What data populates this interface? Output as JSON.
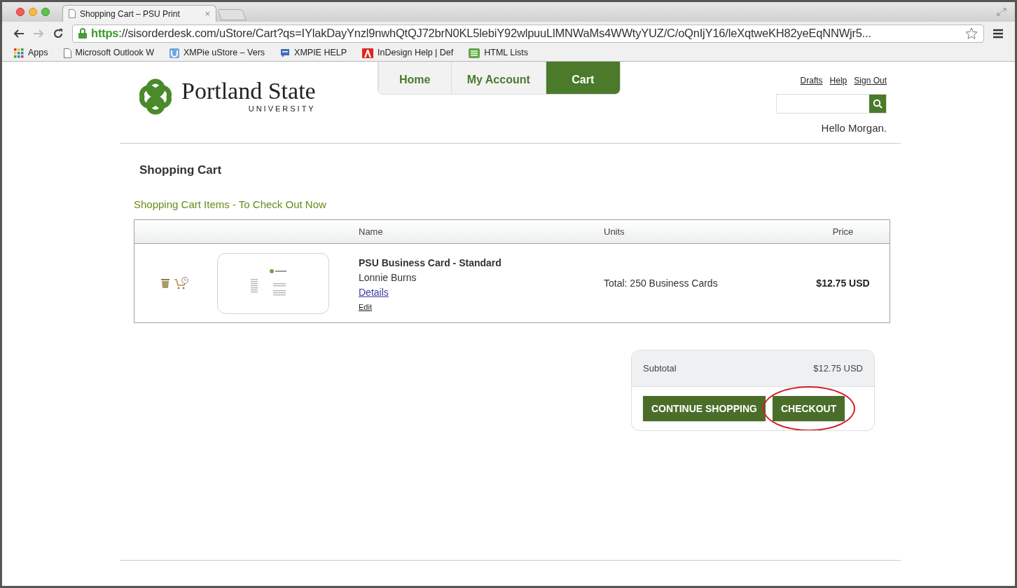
{
  "browser": {
    "tab_title": "Shopping Cart – PSU Print",
    "tab_close": "×",
    "url_scheme": "https",
    "url_rest": "://sisorderdesk.com/uStore/Cart?qs=IYlakDayYnzl9nwhQtQJ72brN0KL5lebiY92wlpuuLlMNWaMs4WWtyYUZ/C/oQnIjY16/leXqtweKH82yeEqNNWjr5...",
    "bookmarks": [
      {
        "label": "Apps",
        "kind": "apps"
      },
      {
        "label": "Microsoft Outlook W",
        "kind": "page"
      },
      {
        "label": "XMPie uStore – Vers",
        "kind": "ustore"
      },
      {
        "label": "XMPIE HELP",
        "kind": "help"
      },
      {
        "label": "InDesign Help | Def",
        "kind": "adobe"
      },
      {
        "label": "HTML Lists",
        "kind": "lists"
      }
    ]
  },
  "site": {
    "logo_name": "Portland State",
    "logo_sub": "UNIVERSITY",
    "nav": [
      {
        "label": "Home",
        "selected": false
      },
      {
        "label": "My Account",
        "selected": false
      },
      {
        "label": "Cart",
        "selected": true
      }
    ],
    "top_links": [
      "Drafts",
      "Help",
      "Sign Out"
    ],
    "greeting": "Hello Morgan."
  },
  "page_title": "Shopping Cart",
  "section_title": "Shopping Cart Items - To Check Out Now",
  "table": {
    "columns": [
      "Name",
      "Units",
      "Price"
    ],
    "rows": [
      {
        "name": "PSU Business Card - Standard",
        "recipient": "Lonnie Burns",
        "details": "Details",
        "edit": "Edit",
        "units": "Total: 250 Business Cards",
        "price": "$12.75 USD"
      }
    ]
  },
  "summary": {
    "label": "Subtotal",
    "value": "$12.75 USD",
    "buttons": [
      {
        "label": "CONTINUE SHOPPING",
        "highlighted": false
      },
      {
        "label": "CHECKOUT",
        "highlighted": true
      }
    ]
  }
}
